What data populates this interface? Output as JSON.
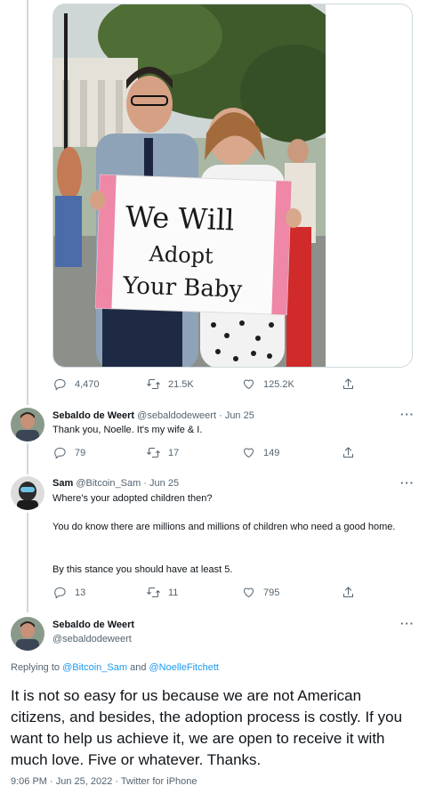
{
  "photo_card": {
    "sign_lines": [
      "We Will",
      "Adopt",
      "Your Baby"
    ]
  },
  "tweet0": {
    "replies": "4,470",
    "retweets": "21.5K",
    "likes": "125.2K"
  },
  "tweet1": {
    "name": "Sebaldo de Weert",
    "handle": "@sebaldodeweert",
    "date": "Jun 25",
    "sep": "·",
    "text": "Thank you, Noelle. It's my wife & I.",
    "replies": "79",
    "retweets": "17",
    "likes": "149"
  },
  "tweet2": {
    "name": "Sam",
    "handle": "@Bitcoin_Sam",
    "date": "Jun 25",
    "sep": "·",
    "para1": "Where's your adopted children then?",
    "para2": "You do know there are millions and millions of children who need a good home.",
    "para3": "By this stance you should have at least 5.",
    "replies": "13",
    "retweets": "11",
    "likes": "795"
  },
  "main_tweet": {
    "name": "Sebaldo de Weert",
    "handle": "@sebaldodeweert",
    "replying_prefix": "Replying to",
    "replying_user1": "@Bitcoin_Sam",
    "replying_and": "and",
    "replying_user2": "@NoelleFitchett",
    "text": "It is not so easy for us because we are not American citizens, and besides, the adoption process is costly. If you want to help us achieve it, we are open to receive it with much love.  Five or whatever.  Thanks.",
    "timestamp": "9:06 PM · Jun 25, 2022 · Twitter for iPhone"
  },
  "more_label": "···",
  "colors": {
    "accent": "#1d9bf0",
    "muted": "#536471",
    "border": "#cfd9de"
  },
  "icons": [
    "reply-icon",
    "retweet-icon",
    "like-icon",
    "share-icon",
    "more-icon"
  ]
}
